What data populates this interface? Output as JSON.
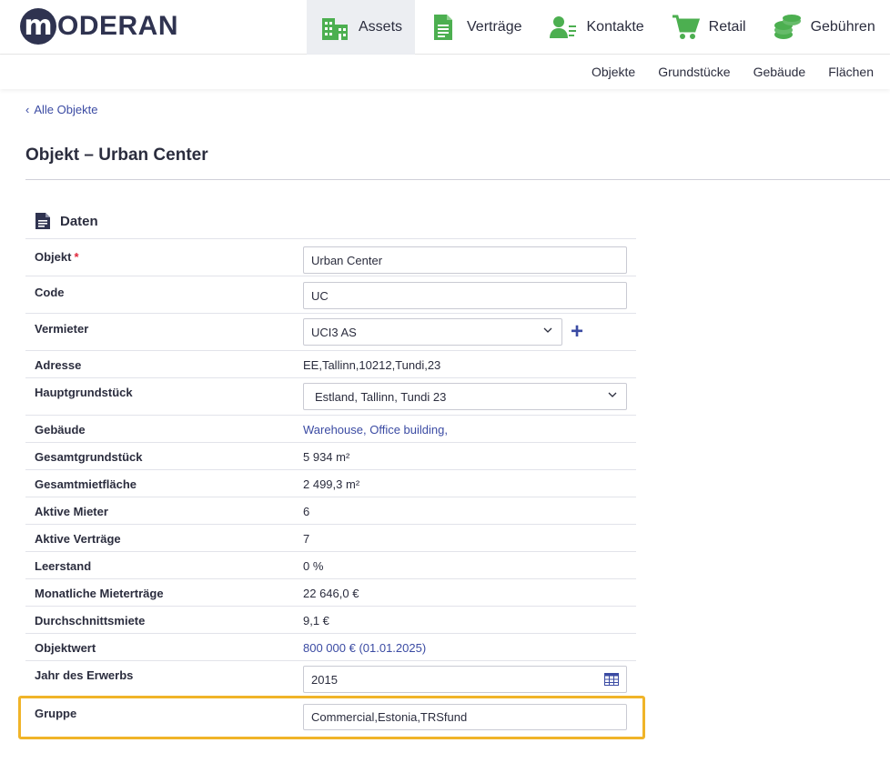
{
  "brand": {
    "logo_letter": "m",
    "logo_text": "ODERAN"
  },
  "nav": [
    {
      "label": "Assets",
      "icon": "building-icon",
      "active": true
    },
    {
      "label": "Verträge",
      "icon": "document-icon",
      "active": false
    },
    {
      "label": "Kontakte",
      "icon": "contact-icon",
      "active": false
    },
    {
      "label": "Retail",
      "icon": "cart-icon",
      "active": false
    },
    {
      "label": "Gebühren",
      "icon": "coins-icon",
      "active": false
    }
  ],
  "subnav": [
    "Objekte",
    "Grundstücke",
    "Gebäude",
    "Flächen"
  ],
  "breadcrumb": {
    "chevron": "‹",
    "label": "Alle Objekte"
  },
  "page": {
    "title": "Objekt – Urban Center"
  },
  "section": {
    "title": "Daten"
  },
  "fields": {
    "objekt": {
      "label": "Objekt",
      "required_mark": "*",
      "value": "Urban Center"
    },
    "code": {
      "label": "Code",
      "value": "UC"
    },
    "vermieter": {
      "label": "Vermieter",
      "value": "UCI3 AS",
      "add_symbol": "+"
    },
    "adresse": {
      "label": "Adresse",
      "value": "EE,Tallinn,10212,Tundi,23"
    },
    "hauptgrundstueck": {
      "label": "Hauptgrundstück",
      "value": "Estland, Tallinn, Tundi 23"
    },
    "gebaeude": {
      "label": "Gebäude",
      "value": "Warehouse, Office building,"
    },
    "gesamtgrundstueck": {
      "label": "Gesamtgrundstück",
      "value": "5 934 m²"
    },
    "gesamtmietflaeche": {
      "label": "Gesamtmietfläche",
      "value": "2 499,3 m²"
    },
    "aktive_mieter": {
      "label": "Aktive Mieter",
      "value": "6"
    },
    "aktive_vertraege": {
      "label": "Aktive Verträge",
      "value": "7"
    },
    "leerstand": {
      "label": "Leerstand",
      "value": "0 %"
    },
    "monatliche_mietertraege": {
      "label": "Monatliche Mieterträge",
      "value": "22 646,0 €"
    },
    "durchschnittsmiete": {
      "label": "Durchschnittsmiete",
      "value": "9,1 €"
    },
    "objektwert": {
      "label": "Objektwert",
      "value": "800 000 € (01.01.2025)"
    },
    "jahr_des_erwerbs": {
      "label": "Jahr des Erwerbs",
      "value": "2015"
    },
    "gruppe": {
      "label": "Gruppe",
      "value": "Commercial,Estonia,TRSfund"
    }
  },
  "colors": {
    "accent": "#3b4ba3",
    "nav_icon": "#4caf50",
    "highlight": "#f0b429",
    "required": "#e0263a"
  }
}
